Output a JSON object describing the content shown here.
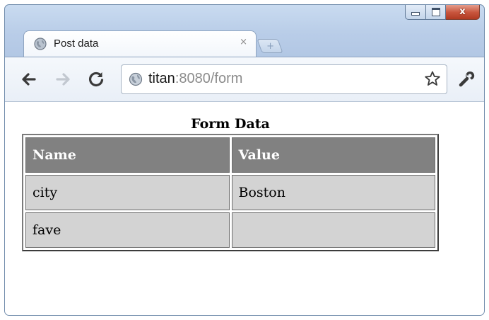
{
  "window": {
    "title": "Post data",
    "controls": {
      "minimize": "minimize",
      "maximize": "maximize",
      "close": "x"
    }
  },
  "tab": {
    "title": "Post data",
    "close_glyph": "×",
    "favicon": "globe-icon"
  },
  "newtab": {
    "glyph": "+"
  },
  "toolbar": {
    "back_icon": "back-arrow-icon",
    "forward_icon": "forward-arrow-icon",
    "reload_icon": "reload-icon",
    "wrench_icon": "wrench-icon"
  },
  "address": {
    "host": "titan",
    "rest": ":8080/form",
    "bookmark_icon": "star-icon"
  },
  "page": {
    "heading": "Form Data",
    "table": {
      "headers": [
        "Name",
        "Value"
      ],
      "rows": [
        [
          "city",
          "Boston"
        ],
        [
          "fave",
          ""
        ]
      ]
    }
  },
  "colors": {
    "header_bg": "#818181",
    "cell_bg": "#d3d3d3",
    "frame_blue": "#b9cde8"
  }
}
